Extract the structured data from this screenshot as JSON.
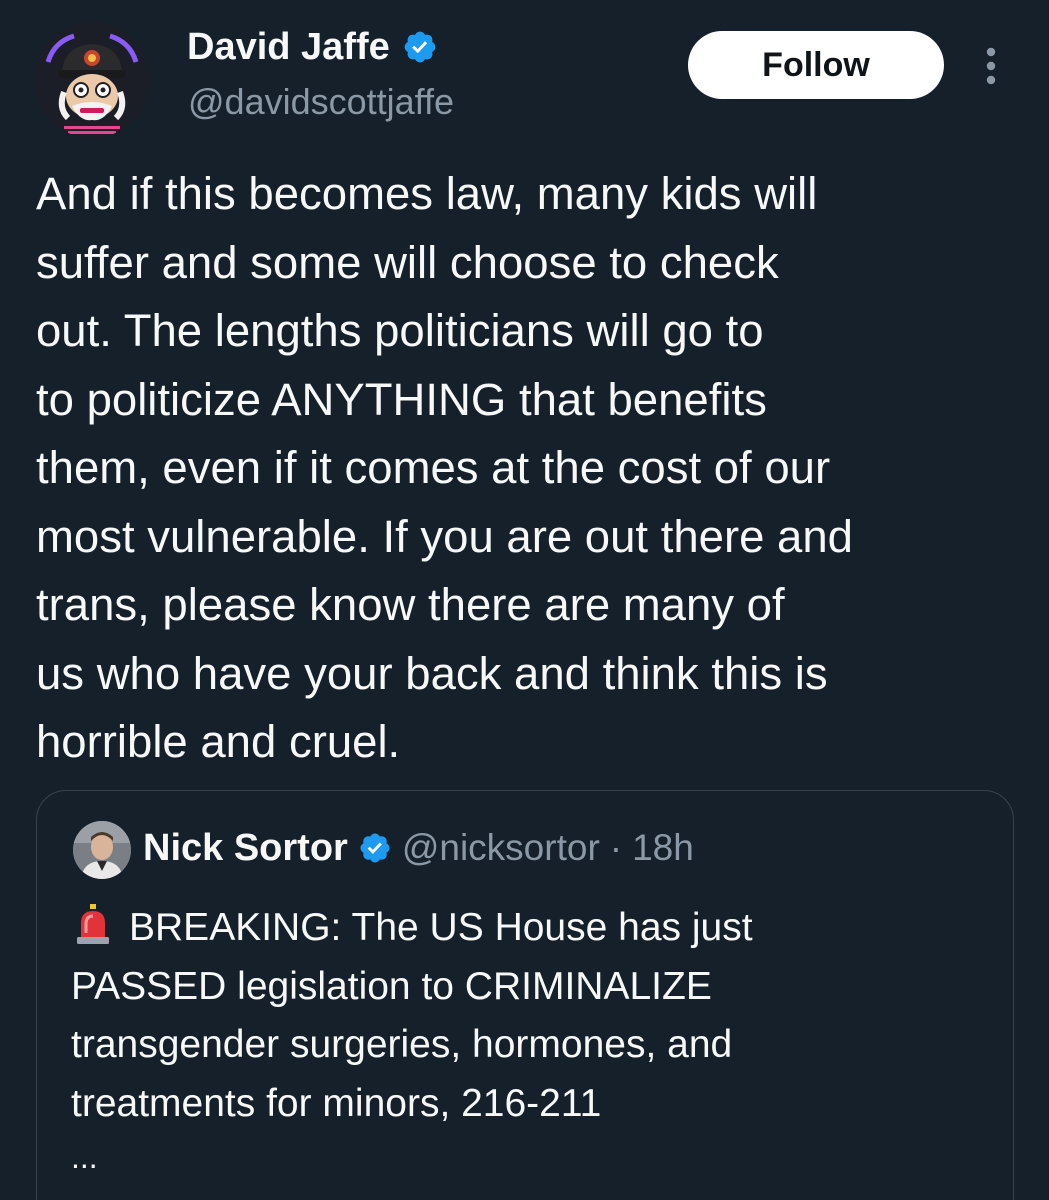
{
  "author": {
    "display_name": "David Jaffe",
    "handle": "@davidscottjaffe",
    "verified": true,
    "avatar_icon": "avatar-icon"
  },
  "actions": {
    "follow_label": "Follow",
    "more_icon": "more-vertical-icon"
  },
  "tweet": {
    "lines": [
      "And if this becomes law, many kids will",
      "suffer and some will choose to check",
      "out. The lengths politicians will go to",
      "to politicize ANYTHING that benefits",
      "them, even if it comes at the cost of our",
      "most vulnerable. If you are out there and",
      "trans, please know there are many of",
      "us who have your back and think this is",
      "horrible and cruel."
    ]
  },
  "quoted": {
    "display_name": "Nick Sortor",
    "handle": "@nicksortor",
    "separator": "·",
    "time": "18h",
    "verified": true,
    "siren_icon": "siren-icon",
    "lines": [
      "BREAKING: The US House has just",
      "PASSED legislation to CRIMINALIZE",
      "transgender surgeries, hormones, and",
      "treatments for minors, 216-211"
    ],
    "truncation": "..."
  },
  "colors": {
    "background": "#15202b",
    "text": "#f7f9f9",
    "secondary_text": "#8b98a5",
    "verified_blue": "#1d9bf0",
    "border": "#38444d",
    "follow_bg": "#ffffff"
  }
}
